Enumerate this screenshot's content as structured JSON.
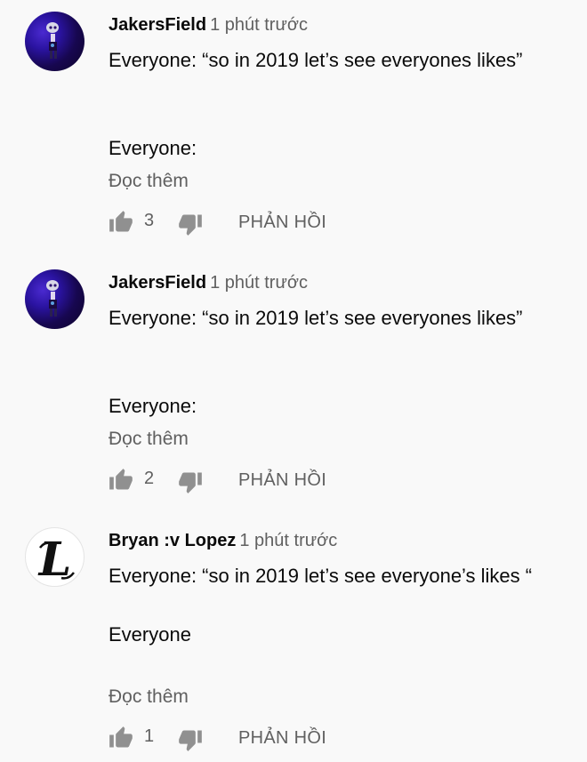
{
  "comments": [
    {
      "author": "JakersField",
      "time": "1 phút trước",
      "avatar": "purple-figure-avatar",
      "lines": [
        "Everyone: “so in 2019 let’s see everyones likes”",
        "Everyone:"
      ],
      "read_more": "Đọc thêm",
      "likes": "3",
      "reply": "PHẢN HỒI"
    },
    {
      "author": "JakersField",
      "time": "1 phút trước",
      "avatar": "purple-figure-avatar",
      "lines": [
        "Everyone: “so in 2019 let’s see everyones likes”",
        "Everyone:"
      ],
      "read_more": "Đọc thêm",
      "likes": "2",
      "reply": "PHẢN HỒI"
    },
    {
      "author": "Bryan :v Lopez",
      "time": "1 phút trước",
      "avatar": "letter-L-avatar",
      "lines": [
        "Everyone: “so in 2019 let’s see everyone’s likes “",
        "Everyone"
      ],
      "read_more": "Đọc thêm",
      "likes": "1",
      "reply": "PHẢN HỒI"
    }
  ],
  "icons": {
    "like": "thumbs-up-icon",
    "dislike": "thumbs-down-icon"
  },
  "colors": {
    "background": "#f9f9f9",
    "text": "#0a0a0a",
    "secondary": "#606060",
    "icon": "#909090"
  }
}
